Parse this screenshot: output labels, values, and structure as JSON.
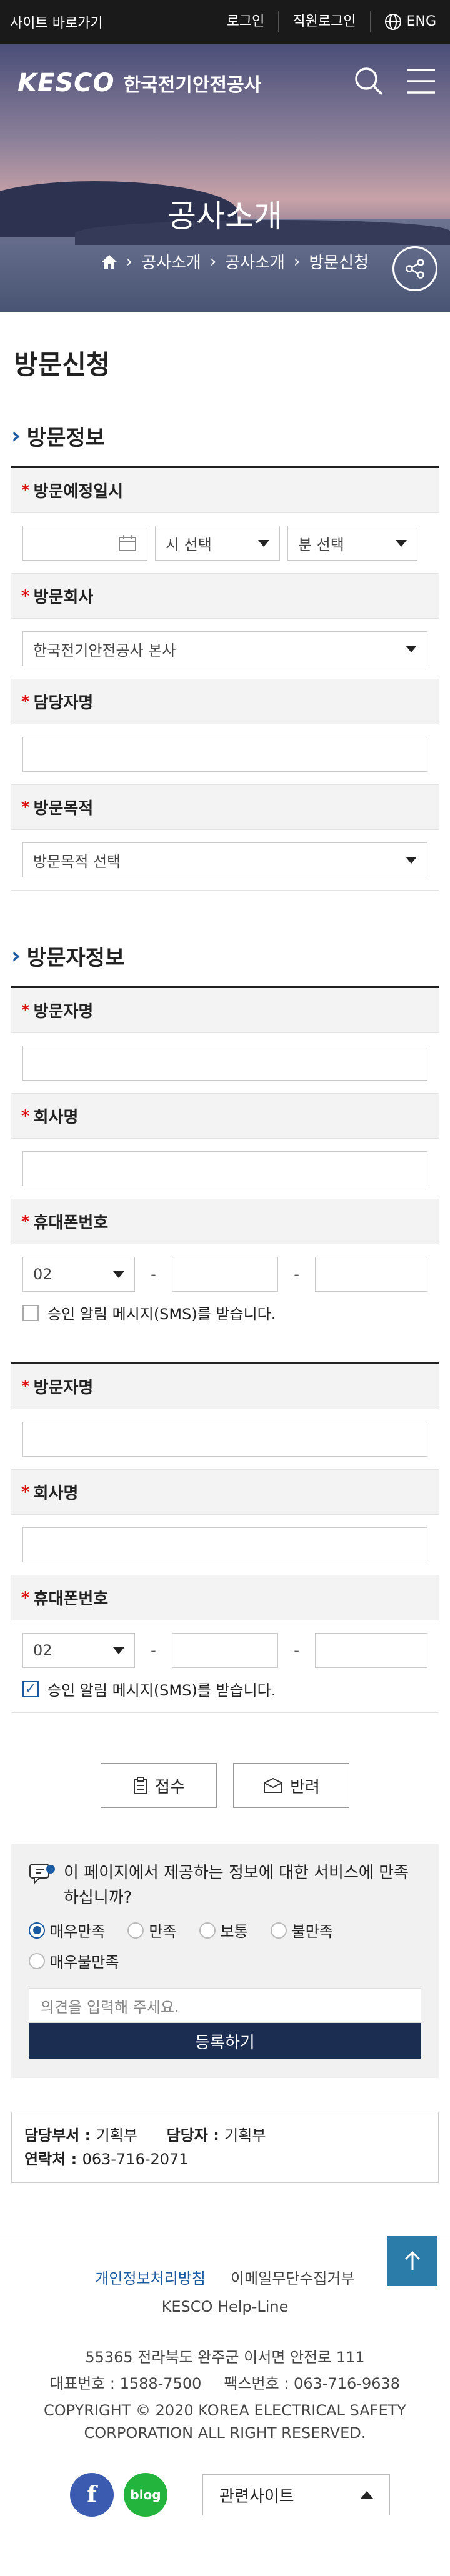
{
  "topbar": {
    "skip": "사이트 바로가기",
    "login": "로그인",
    "staff_login": "직원로그인",
    "lang": "ENG"
  },
  "header": {
    "logo_en": "KESCO",
    "logo_kr": "한국전기안전공사"
  },
  "hero": {
    "title": "공사소개",
    "breadcrumb": [
      "공사소개",
      "공사소개",
      "방문신청"
    ]
  },
  "page_title": "방문신청",
  "visit_info": {
    "section_title": "방문정보",
    "date_label": "방문예정일시",
    "hour_select": "시 선택",
    "minute_select": "분 선택",
    "company_label": "방문회사",
    "company_value": "한국전기안전공사 본사",
    "staff_label": "담당자명",
    "purpose_label": "방문목적",
    "purpose_value": "방문목적 선택"
  },
  "visitor_info": {
    "section_title": "방문자정보",
    "visitors": [
      {
        "name_label": "방문자명",
        "company_label": "회사명",
        "phone_label": "휴대폰번호",
        "phone_prefix": "02",
        "sms_label": "승인 알림 메시지(SMS)를 받습니다.",
        "sms_checked": false
      },
      {
        "name_label": "방문자명",
        "company_label": "회사명",
        "phone_label": "휴대폰번호",
        "phone_prefix": "02",
        "sms_label": "승인 알림 메시지(SMS)를 받습니다.",
        "sms_checked": true
      }
    ]
  },
  "actions": {
    "accept": "접수",
    "reject": "반려"
  },
  "survey": {
    "question": "이 페이지에서 제공하는 정보에 대한 서비스에 만족하십니까?",
    "options": [
      "매우만족",
      "만족",
      "보통",
      "불만족",
      "매우불만족"
    ],
    "selected": "매우만족",
    "opinion_placeholder": "의견을 입력해 주세요.",
    "submit": "등록하기"
  },
  "contact": {
    "dept_label": "담당부서 :",
    "dept_value": "기획부",
    "staff_label": "담당자 :",
    "staff_value": "기획부",
    "phone_label": "연락처 :",
    "phone_value": "063-716-2071"
  },
  "footer": {
    "privacy": "개인정보처리방침",
    "email_refuse": "이메일무단수집거부",
    "helpline": "KESCO Help-Line",
    "address": "55365 전라북도 완주군 이서면 안전로 111",
    "tel": "대표번호 : 1588-7500",
    "fax": "팩스번호 : 063-716-9638",
    "copyright1": "COPYRIGHT © 2020 KOREA ELECTRICAL SAFETY",
    "copyright2": "CORPORATION ALL RIGHT RESERVED.",
    "blog": "blog",
    "related": "관련사이트"
  },
  "colors": {
    "accent": "#1a5aa0",
    "navy": "#1b2e52",
    "required": "#dd1111",
    "top_button": "#2b7ca8"
  }
}
